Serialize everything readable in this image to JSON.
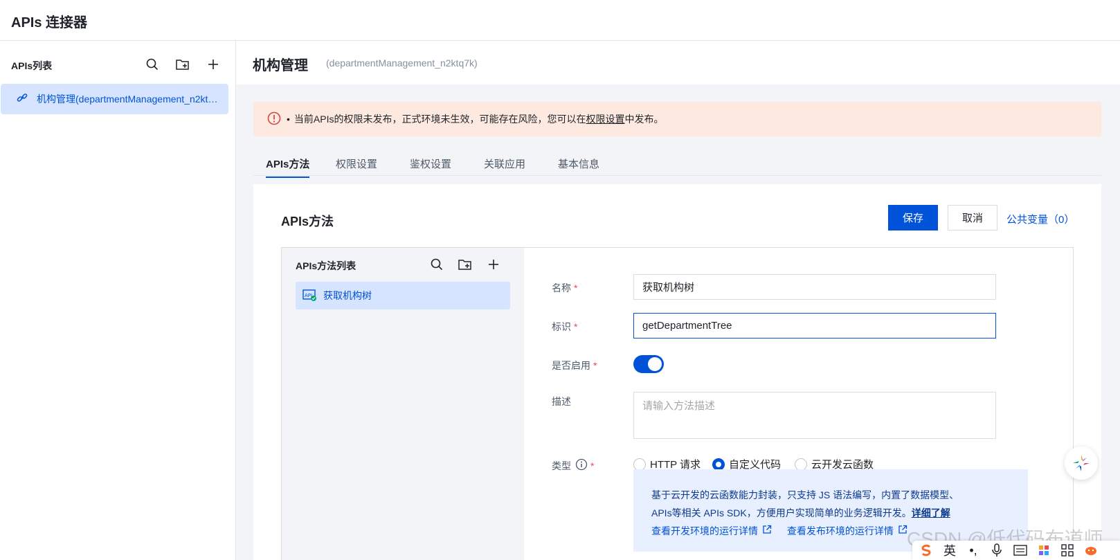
{
  "app": {
    "title": "APIs 连接器"
  },
  "sidebar": {
    "title": "APIs列表",
    "items": [
      {
        "label": "机构管理(departmentManagement_n2ktq7k)"
      }
    ]
  },
  "header": {
    "title": "机构管理",
    "identifier": "(departmentManagement_n2ktq7k)"
  },
  "alert": {
    "bullet": "•",
    "prefix": "当前APIs的权限未发布，正式环境未生效，可能存在风险，您可以在",
    "link": "权限设置",
    "suffix": "中发布。"
  },
  "tabs": [
    {
      "label": "APIs方法",
      "active": true
    },
    {
      "label": "权限设置",
      "active": false
    },
    {
      "label": "鉴权设置",
      "active": false
    },
    {
      "label": "关联应用",
      "active": false
    },
    {
      "label": "基本信息",
      "active": false
    }
  ],
  "panel": {
    "title": "APIs方法",
    "save_label": "保存",
    "cancel_label": "取消",
    "public_vars_label": "公共变量（0）"
  },
  "method_list": {
    "title": "APIs方法列表",
    "items": [
      {
        "label": "获取机构树"
      }
    ]
  },
  "form": {
    "name_label": "名称",
    "name_value": "获取机构树",
    "id_label": "标识",
    "id_value": "getDepartmentTree",
    "enabled_label": "是否启用",
    "enabled": true,
    "desc_label": "描述",
    "desc_placeholder": "请输入方法描述",
    "type_label": "类型",
    "required_mark": "*",
    "type_options": [
      {
        "label": "HTTP 请求",
        "checked": false
      },
      {
        "label": "自定义代码",
        "checked": true
      },
      {
        "label": "云开发云函数",
        "checked": false
      }
    ]
  },
  "info": {
    "line1": "基于云开发的云函数能力封装，只支持 JS 语法编写，内置了数据模型、",
    "line2": "APIs等相关 APIs SDK，方便用户实现简单的业务逻辑开发。",
    "more_link": "详细了解",
    "dev_link": "查看开发环境的运行详情",
    "prod_link": "查看发布环境的运行详情"
  },
  "watermark": "CSDN @低代码布道师",
  "ime": {
    "lang": "英",
    "punct": "•,"
  },
  "colors": {
    "primary": "#0052d9",
    "selected_bg": "#d6e4ff",
    "alert_bg": "#fde9e0",
    "alert_icon": "#d54941",
    "required": "#e34d59"
  }
}
